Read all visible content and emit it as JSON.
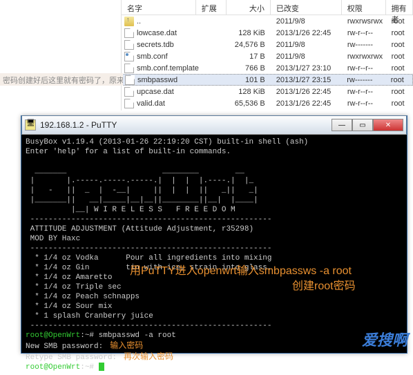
{
  "file_pane": {
    "headers": {
      "name": "名字",
      "ext": "扩展",
      "size": "大小",
      "mod": "已改变",
      "perm": "权限",
      "own": "拥有者"
    },
    "rows": [
      {
        "icon": "up",
        "name": "..",
        "size": "",
        "mod": "2011/9/8",
        "perm": "rwxrwsrwx",
        "own": "root"
      },
      {
        "icon": "file",
        "name": "lowcase.dat",
        "size": "128 KiB",
        "mod": "2013/1/26 22:45",
        "perm": "rw-r--r--",
        "own": "root"
      },
      {
        "icon": "file",
        "name": "secrets.tdb",
        "size": "24,576 B",
        "mod": "2011/9/8",
        "perm": "rw-------",
        "own": "root"
      },
      {
        "icon": "filei",
        "name": "smb.conf",
        "size": "17 B",
        "mod": "2011/9/8",
        "perm": "rwxrwxrwx",
        "own": "root"
      },
      {
        "icon": "file",
        "name": "smb.conf.template",
        "size": "766 B",
        "mod": "2013/1/27 23:10",
        "perm": "rw-r--r--",
        "own": "root"
      },
      {
        "icon": "file",
        "name": "smbpasswd",
        "size": "101 B",
        "mod": "2013/1/27 23:15",
        "perm": "rw-------",
        "own": "root",
        "selected": true
      },
      {
        "icon": "file",
        "name": "upcase.dat",
        "size": "128 KiB",
        "mod": "2013/1/26 22:45",
        "perm": "rw-r--r--",
        "own": "root"
      },
      {
        "icon": "file",
        "name": "valid.dat",
        "size": "65,536 B",
        "mod": "2013/1/26 22:45",
        "perm": "rw-r--r--",
        "own": "root"
      }
    ]
  },
  "annot_left": "密码创建好后这里就有密码了，原来是空的",
  "putty": {
    "title": "192.168.1.2 - PuTTY",
    "btn_min": "—",
    "btn_max": "▭",
    "btn_close": "✕",
    "lines": [
      "BusyBox v1.19.4 (2013-01-26 22:19:20 CST) built-in shell (ash)",
      "Enter 'help' for a list of built-in commands.",
      "",
      "  _______                     ________        __",
      " |       |.-----.-----.-----.|  |  |  |.----.|  |_",
      " |   -   ||  _  |  -__|     ||  |  |  ||   _||   _|",
      " |_______||   __|_____|__|__||________||__|  |____|",
      "          |__| W I R E L E S S   F R E E D O M",
      " -----------------------------------------------------",
      " ATTITUDE ADJUSTMENT (Attitude Adjustment, r35298)",
      " MOD BY Haxc",
      " -----------------------------------------------------",
      "  * 1/4 oz Vodka      Pour all ingredients into mixing",
      "  * 1/4 oz Gin        tin with ice, strain into glass.",
      "  * 1/4 oz Amaretto",
      "  * 1/4 oz Triple sec",
      "  * 1/4 oz Peach schnapps",
      "  * 1/4 oz Sour mix",
      "  * 1 splash Cranberry juice",
      " -----------------------------------------------------"
    ],
    "prompt1_user": "root@OpenWrt",
    "prompt1_path": ":~#",
    "prompt1_cmd": " smbpasswd -a root",
    "line_newpw": "New SMB password:",
    "line_repw": "Retype SMB password:",
    "annot_newpw": "   输入密码",
    "annot_repw": "   再次输入密码",
    "prompt2_cmd": " "
  },
  "annot_big": "用PuTTY进入openwrt输入smbpassws -a root",
  "annot_big2": "创建root密码",
  "watermark": "爱搜啊"
}
